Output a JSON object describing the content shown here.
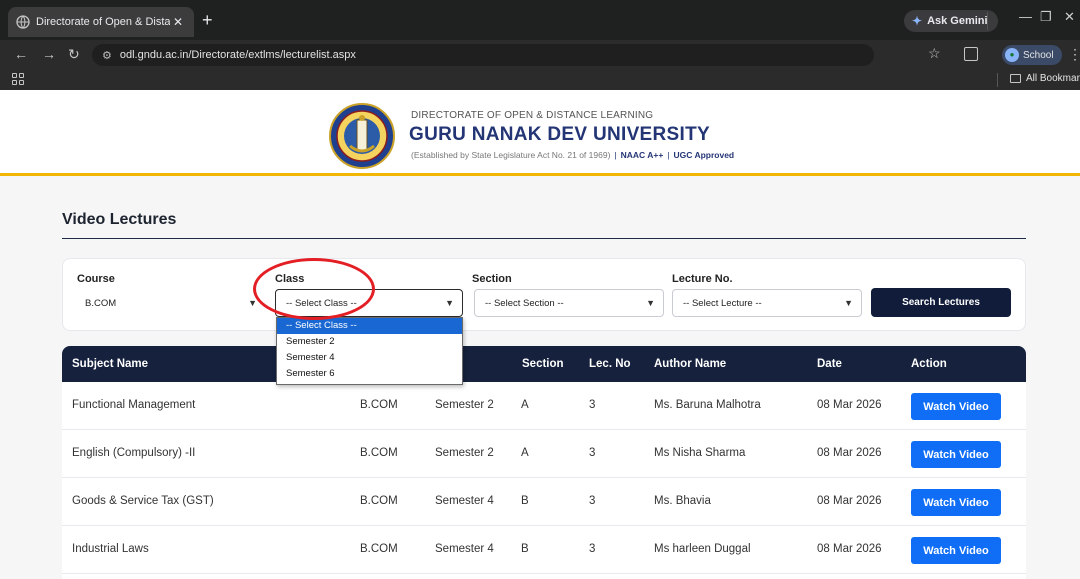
{
  "browser": {
    "tab_title": "Directorate of Open & Distance",
    "tab_close": "✕",
    "new_tab": "+",
    "gemini_label": "Ask Gemini",
    "url": "odl.gndu.ac.in/Directorate/extlms/lecturelist.aspx",
    "profile_label": "School",
    "all_bookmarks": "All Bookmarks"
  },
  "header": {
    "pre_title": "DIRECTORATE OF OPEN & DISTANCE LEARNING",
    "title": "GURU NANAK DEV UNIVERSITY",
    "established": "(Established by State Legislature Act No. 21 of 1969)",
    "separator": "|",
    "naac": "NAAC A++",
    "ugc": "UGC Approved"
  },
  "page": {
    "section_title": "Video Lectures"
  },
  "filters": {
    "course_label": "Course",
    "course_value": "B.COM",
    "class_label": "Class",
    "class_value": "-- Select Class --",
    "section_label": "Section",
    "section_value": "-- Select Section --",
    "lecture_label": "Lecture No.",
    "lecture_value": "-- Select Lecture --",
    "search_button": "Search Lectures"
  },
  "class_dropdown": {
    "options": [
      "-- Select Class --",
      "Semester 2",
      "Semester 4",
      "Semester 6"
    ],
    "selected_index": 0
  },
  "table": {
    "headers": {
      "subject": "Subject Name",
      "section": "Section",
      "lec_no": "Lec. No",
      "author": "Author Name",
      "date": "Date",
      "action": "Action"
    },
    "rows": [
      {
        "subject": "Functional Management",
        "course": "B.COM",
        "class": "Semester 2",
        "section": "A",
        "lec_no": "3",
        "author": "Ms. Baruna Malhotra",
        "date": "08 Mar 2026",
        "action": "Watch Video"
      },
      {
        "subject": "English (Compulsory) -II",
        "course": "B.COM",
        "class": "Semester 2",
        "section": "A",
        "lec_no": "3",
        "author": "Ms Nisha Sharma",
        "date": "08 Mar 2026",
        "action": "Watch Video"
      },
      {
        "subject": "Goods & Service Tax (GST)",
        "course": "B.COM",
        "class": "Semester 4",
        "section": "B",
        "lec_no": "3",
        "author": "Ms. Bhavia",
        "date": "08 Mar 2026",
        "action": "Watch Video"
      },
      {
        "subject": "Industrial Laws",
        "course": "B.COM",
        "class": "Semester 4",
        "section": "B",
        "lec_no": "3",
        "author": "Ms harleen Duggal",
        "date": "08 Mar 2026",
        "action": "Watch Video"
      }
    ]
  },
  "colors": {
    "header_accent": "#f2b705",
    "navy": "#15213d",
    "button_blue": "#0f6ef5",
    "annotation_red": "#e31e24"
  }
}
